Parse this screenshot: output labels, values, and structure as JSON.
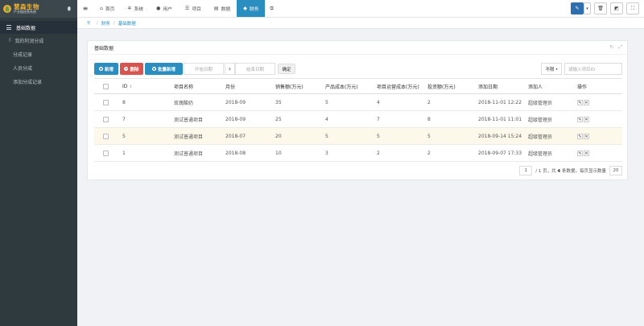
{
  "app": {
    "name": "慧森生物",
    "tagline": "产业链经营系统"
  },
  "sidebar": {
    "group_label": "基础数据",
    "items": [
      {
        "label": "我的利润分成"
      },
      {
        "label": "分成记录"
      },
      {
        "label": "人员分成"
      },
      {
        "label": "添加分成记录"
      }
    ]
  },
  "topbar": {
    "tabs": [
      {
        "label": "首页",
        "icon": "home-icon"
      },
      {
        "label": "系统",
        "icon": "gear-icon"
      },
      {
        "label": "用户",
        "icon": "user-icon"
      },
      {
        "label": "项目",
        "icon": "list-icon"
      },
      {
        "label": "数据",
        "icon": "database-icon"
      },
      {
        "label": "财务",
        "icon": "diamond-icon",
        "active": true
      }
    ]
  },
  "breadcrumb": {
    "items": [
      "财务",
      "基础数据"
    ]
  },
  "panel": {
    "title": "基础数据"
  },
  "toolbar": {
    "add_label": "新增",
    "delete_label": "删除",
    "batch_add_label": "批量新增",
    "start_date_placeholder": "开始日期",
    "end_date_placeholder": "结束日期",
    "confirm_label": "确定",
    "scope_label": "不限",
    "search_placeholder": "请输入项目ID"
  },
  "table": {
    "headers": [
      "ID",
      "项目名称",
      "月份",
      "销售额(万元)",
      "产品成本(万元)",
      "项目运营成本(万元)",
      "投资额(万元)",
      "添加日期",
      "添加人",
      "操作"
    ],
    "rows": [
      {
        "id": "8",
        "name": "玫瑰酸奶",
        "month": "2018-09",
        "sales": "35",
        "product_cost": "5",
        "op_cost": "4",
        "investment": "2",
        "date": "2018-11-01 12:22",
        "adder": "超级管理员"
      },
      {
        "id": "7",
        "name": "测试普通项目",
        "month": "2018-09",
        "sales": "25",
        "product_cost": "4",
        "op_cost": "7",
        "investment": "8",
        "date": "2018-11-01 11:01",
        "adder": "超级管理员"
      },
      {
        "id": "5",
        "name": "测试普通项目",
        "month": "2018-07",
        "sales": "20",
        "product_cost": "5",
        "op_cost": "5",
        "investment": "5",
        "date": "2018-09-14 15:24",
        "adder": "超级管理员"
      },
      {
        "id": "1",
        "name": "测试普通项目",
        "month": "2018-08",
        "sales": "10",
        "product_cost": "3",
        "op_cost": "2",
        "investment": "2",
        "date": "2018-09-07 17:33",
        "adder": "超级管理员"
      }
    ]
  },
  "pager": {
    "current_page": "1",
    "text_a": "/ 1 页，共",
    "total": "4",
    "text_b": "条数据，每页显示数量",
    "page_size": "20"
  }
}
